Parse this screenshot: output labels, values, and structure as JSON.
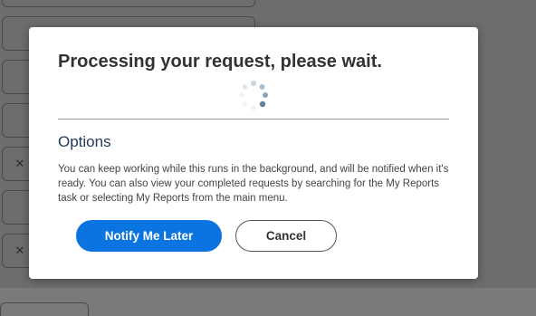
{
  "background": {
    "remove_glyph": "✕"
  },
  "dialog": {
    "title": "Processing your request, please wait.",
    "options_heading": "Options",
    "options_text": "You can keep working while this runs in the background, and will be notified when it's ready. You can also view your completed requests by searching for the My Reports task or selecting My Reports from the main menu.",
    "buttons": {
      "notify_label": "Notify Me Later",
      "cancel_label": "Cancel"
    }
  },
  "colors": {
    "primary_button": "#0c74e0",
    "heading_blue": "#1e3a5a",
    "overlay": "#6d6d6d"
  }
}
